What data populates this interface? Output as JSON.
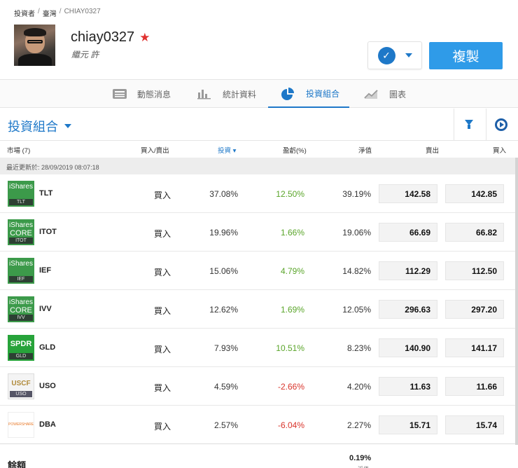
{
  "breadcrumb": [
    "投資者",
    "臺灣",
    "CHIAY0327"
  ],
  "profile": {
    "username": "chiay0327",
    "real_name": "繼元 許"
  },
  "actions": {
    "copy_label": "複製"
  },
  "tabs": [
    {
      "label": "動態消息",
      "icon": "news-icon"
    },
    {
      "label": "統計資料",
      "icon": "bar-chart-icon"
    },
    {
      "label": "投資組合",
      "icon": "pie-chart-icon",
      "active": true
    },
    {
      "label": "圖表",
      "icon": "line-chart-icon"
    }
  ],
  "portfolio": {
    "title": "投資組合"
  },
  "columns": {
    "market": "市場 (7)",
    "buy_sell": "買入/賣出",
    "invested": "投資",
    "pl": "盈虧(%)",
    "value": "淨值",
    "sell": "賣出",
    "buy": "買入"
  },
  "last_updated": "最近更新於: 28/09/2019 08:07:18",
  "holdings": [
    {
      "ticker": "TLT",
      "logo_brand": "iShares",
      "logo_brand2": "",
      "logo_sym": "TLT",
      "action": "買入",
      "invested": "37.08%",
      "pl": "12.50%",
      "value": "39.19%",
      "sell": "142.58",
      "buy": "142.85"
    },
    {
      "ticker": "ITOT",
      "logo_brand": "iShares",
      "logo_brand2": "CORE",
      "logo_sym": "ITOT",
      "action": "買入",
      "invested": "19.96%",
      "pl": "1.66%",
      "value": "19.06%",
      "sell": "66.69",
      "buy": "66.82"
    },
    {
      "ticker": "IEF",
      "logo_brand": "iShares",
      "logo_brand2": "",
      "logo_sym": "IEF",
      "action": "買入",
      "invested": "15.06%",
      "pl": "4.79%",
      "value": "14.82%",
      "sell": "112.29",
      "buy": "112.50"
    },
    {
      "ticker": "IVV",
      "logo_brand": "iShares",
      "logo_brand2": "CORE",
      "logo_sym": "IVV",
      "action": "買入",
      "invested": "12.62%",
      "pl": "1.69%",
      "value": "12.05%",
      "sell": "296.63",
      "buy": "297.20"
    },
    {
      "ticker": "GLD",
      "logo_brand": "SPDR",
      "logo_brand2": "",
      "logo_sym": "GLD",
      "action": "買入",
      "invested": "7.93%",
      "pl": "10.51%",
      "value": "8.23%",
      "sell": "140.90",
      "buy": "141.17"
    },
    {
      "ticker": "USO",
      "logo_brand": "USCF",
      "logo_brand2": "",
      "logo_sym": "USO",
      "action": "買入",
      "invested": "4.59%",
      "pl": "-2.66%",
      "value": "4.20%",
      "sell": "11.63",
      "buy": "11.66"
    },
    {
      "ticker": "DBA",
      "logo_brand": "POWERSHARES",
      "logo_brand2": "",
      "logo_sym": "",
      "action": "買入",
      "invested": "2.57%",
      "pl": "-6.04%",
      "value": "2.27%",
      "sell": "15.71",
      "buy": "15.74"
    }
  ],
  "cash": {
    "label": "餘額",
    "value": "0.19%"
  },
  "colors": {
    "accent": "#1e78c8",
    "copy_button": "#2f9be8",
    "positive": "#5aa52a",
    "negative": "#d9342b",
    "star": "#e0312f"
  }
}
